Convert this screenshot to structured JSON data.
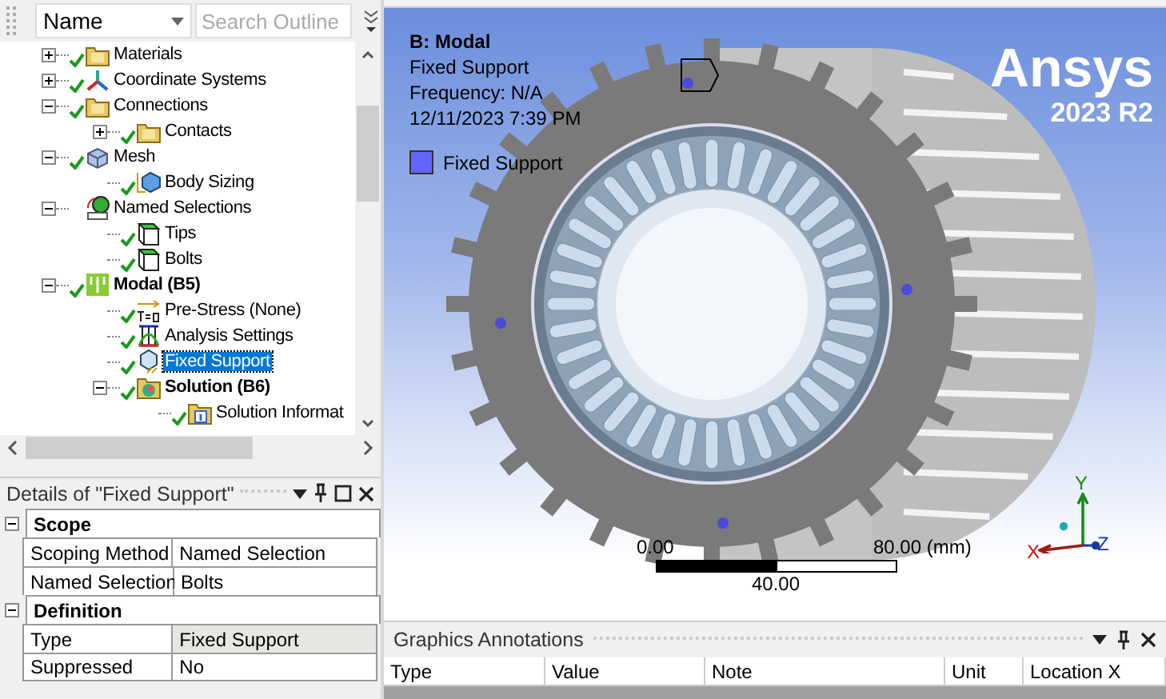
{
  "outline": {
    "name_filter": "Name",
    "search": {
      "placeholder": "Search Outline"
    },
    "tree": [
      {
        "label": "Materials",
        "kind": "folder",
        "expanded": false,
        "checked": true,
        "bold": false,
        "selected": false
      },
      {
        "label": "Coordinate Systems",
        "kind": "axes",
        "expanded": false,
        "checked": true,
        "bold": false,
        "selected": false
      },
      {
        "label": "Connections",
        "kind": "folder",
        "expanded": true,
        "checked": true,
        "bold": false,
        "selected": false,
        "children": [
          {
            "label": "Contacts",
            "kind": "folder",
            "expanded": false,
            "checked": true,
            "bold": false,
            "selected": false
          }
        ]
      },
      {
        "label": "Mesh",
        "kind": "mesh",
        "expanded": true,
        "checked": true,
        "bold": false,
        "selected": false,
        "children": [
          {
            "label": "Body Sizing",
            "kind": "sizing",
            "checked": true,
            "bold": false,
            "selected": false
          }
        ]
      },
      {
        "label": "Named Selections",
        "kind": "named",
        "expanded": true,
        "checked": false,
        "bold": false,
        "selected": false,
        "children": [
          {
            "label": "Tips",
            "kind": "selection",
            "checked": true,
            "bold": false,
            "selected": false
          },
          {
            "label": "Bolts",
            "kind": "selection",
            "checked": true,
            "bold": false,
            "selected": false
          }
        ]
      },
      {
        "label": "Modal (B5)",
        "kind": "analysis",
        "expanded": true,
        "checked": true,
        "bold": true,
        "selected": false,
        "children": [
          {
            "label": "Pre-Stress (None)",
            "kind": "prestress",
            "checked": true,
            "bold": false,
            "selected": false
          },
          {
            "label": "Analysis Settings",
            "kind": "settings",
            "checked": true,
            "bold": false,
            "selected": false
          },
          {
            "label": "Fixed Support",
            "kind": "support",
            "checked": true,
            "bold": false,
            "selected": true
          },
          {
            "label": "Solution (B6)",
            "kind": "solution",
            "expanded": true,
            "checked": true,
            "bold": true,
            "selected": false,
            "children": [
              {
                "label": "Solution Informat",
                "kind": "info",
                "checked": true,
                "bold": false,
                "selected": false
              }
            ]
          }
        ]
      }
    ]
  },
  "details": {
    "title": "Details of \"Fixed Support\"",
    "groups": [
      {
        "title": "Scope",
        "expanded": true,
        "rows": [
          {
            "label": "Scoping Method",
            "value": "Named Selection",
            "selected": false
          },
          {
            "label": "Named Selection",
            "value": "Bolts",
            "selected": false
          }
        ]
      },
      {
        "title": "Definition",
        "expanded": true,
        "rows": [
          {
            "label": "Type",
            "value": "Fixed Support",
            "selected": true
          },
          {
            "label": "Suppressed",
            "value": "No",
            "selected": false
          }
        ]
      }
    ]
  },
  "viewport": {
    "title": "B: Modal",
    "lines": [
      "Fixed Support",
      "Frequency: N/A",
      "12/11/2023 7:39 PM"
    ],
    "legend": [
      {
        "label": "Fixed Support",
        "color": "#6464ff"
      }
    ],
    "logo": {
      "name": "Ansys",
      "version": "2023 R2"
    },
    "scale": {
      "start": "0.00",
      "end": "80.00",
      "unit": "(mm)",
      "middle": "40.00"
    },
    "triad": {
      "x": "X",
      "y": "Y",
      "z": "Z"
    }
  },
  "annotations": {
    "title": "Graphics Annotations",
    "columns": [
      "Type",
      "Value",
      "Note",
      "Unit",
      "Location X"
    ]
  }
}
